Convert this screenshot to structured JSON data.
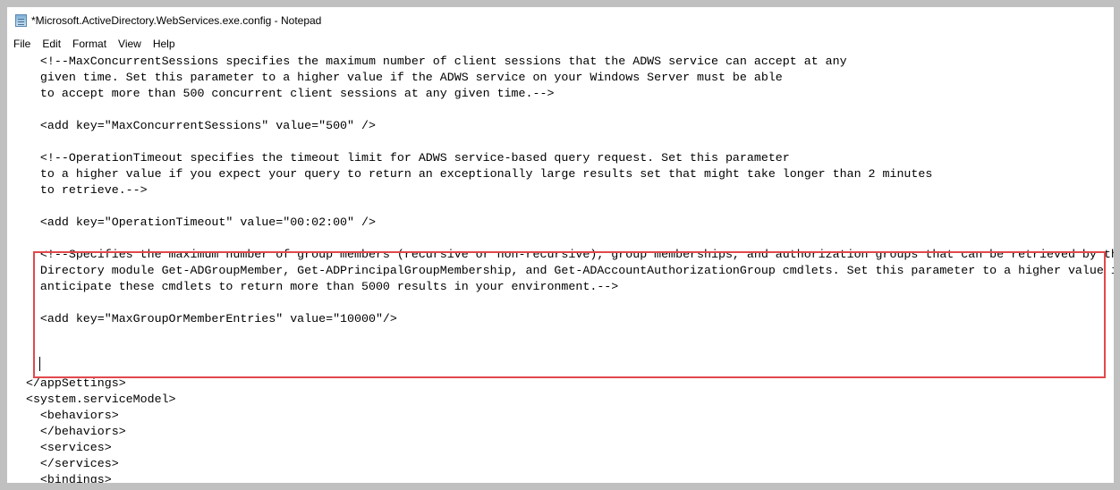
{
  "window": {
    "title": "*Microsoft.ActiveDirectory.WebServices.exe.config - Notepad",
    "icon": "notepad-icon"
  },
  "menu": [
    "File",
    "Edit",
    "Format",
    "View",
    "Help"
  ],
  "editor": {
    "lines": [
      "    <!--MaxConcurrentSessions specifies the maximum number of client sessions that the ADWS service can accept at any",
      "    given time. Set this parameter to a higher value if the ADWS service on your Windows Server must be able",
      "    to accept more than 500 concurrent client sessions at any given time.-->",
      "",
      "    <add key=\"MaxConcurrentSessions\" value=\"500\" />",
      "",
      "    <!--OperationTimeout specifies the timeout limit for ADWS service-based query request. Set this parameter",
      "    to a higher value if you expect your query to return an exceptionally large results set that might take longer than 2 minutes",
      "    to retrieve.-->",
      "",
      "    <add key=\"OperationTimeout\" value=\"00:02:00\" />",
      "",
      "    <!--Specifies the maximum number of group members (recursive or non-recursive), group memberships, and authorization groups that can be retrieved by the Active",
      "    Directory module Get-ADGroupMember, Get-ADPrincipalGroupMembership, and Get-ADAccountAuthorizationGroup cmdlets. Set this parameter to a higher value if you",
      "    anticipate these cmdlets to return more than 5000 results in your environment.-->",
      "",
      "    <add key=\"MaxGroupOrMemberEntries\" value=\"10000\"/>",
      "",
      "",
      "",
      "  </appSettings>",
      "  <system.serviceModel>",
      "    <behaviors>",
      "    </behaviors>",
      "    <services>",
      "    </services>",
      "    <bindings>"
    ],
    "highlight_color": "#e2484c"
  }
}
